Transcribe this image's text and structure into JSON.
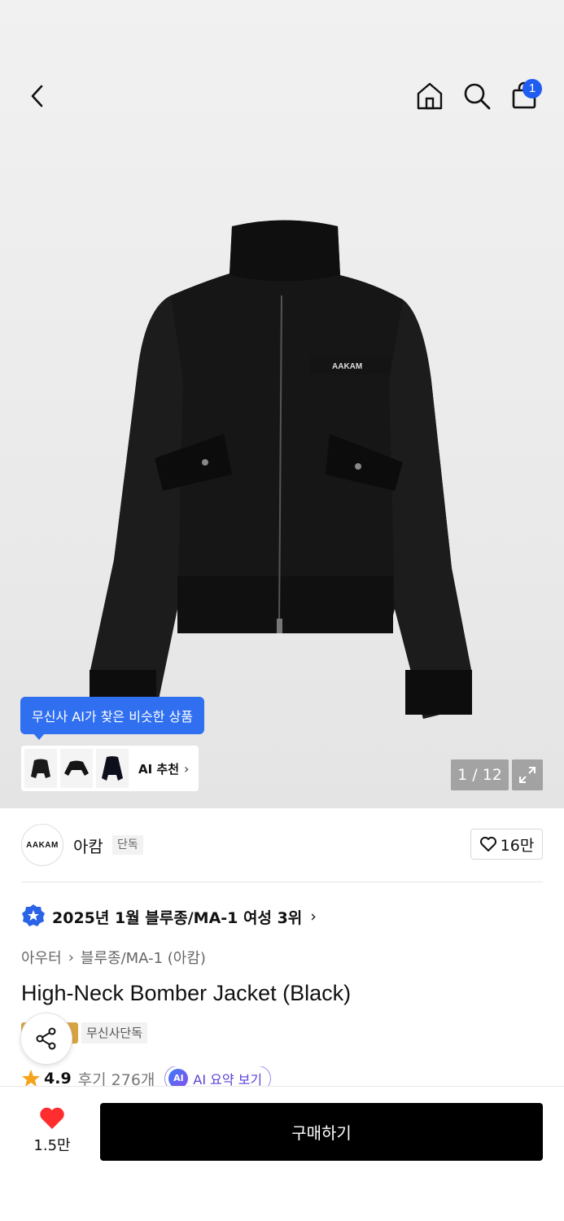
{
  "header": {
    "cart_count": "1"
  },
  "gallery": {
    "ai_tooltip": "무신사 AI가 찾은 비슷한 상품",
    "ai_recommend_label": "AI 추천",
    "page_counter": "1 / 12",
    "jacket_logo_text": "AAKAM"
  },
  "brand": {
    "logo_text": "AAKAM",
    "name": "아캄",
    "tag": "단독",
    "like_count": "16만"
  },
  "ranking": {
    "text": "2025년 1월 블루종/MA-1 여성 3위"
  },
  "breadcrumb": {
    "level1": "아우터",
    "level2": "블루종/MA-1 (아캄)"
  },
  "product": {
    "title": "High-Neck Bomber Jacket (Black)",
    "exclusive_badge": "무신사단독",
    "rating": "4.9",
    "reviews": "후기 276개",
    "ai_summary_icon": "AI",
    "ai_summary": "AI 요약 보기"
  },
  "bottom": {
    "heart_count": "1.5만",
    "buy_label": "구매하기"
  },
  "colors": {
    "accent_blue": "#2f6ff0",
    "badge_blue": "#1f5cf2",
    "heart_red": "#ff2d2d",
    "star_orange": "#f5a31a",
    "buy_black": "#000000"
  }
}
